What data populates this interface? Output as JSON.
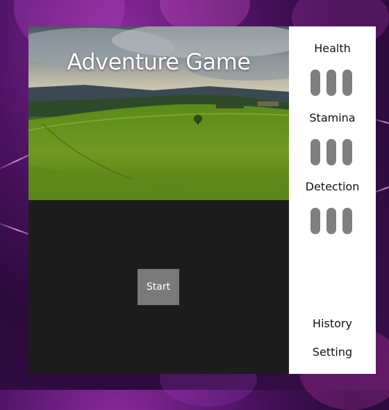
{
  "game": {
    "title": "Adventure Game",
    "start_label": "Start"
  },
  "stats": [
    {
      "label": "Health",
      "value": 3,
      "max": 3
    },
    {
      "label": "Stamina",
      "value": 3,
      "max": 3
    },
    {
      "label": "Detection",
      "value": 3,
      "max": 3
    }
  ],
  "menu": {
    "history_label": "History",
    "setting_label": "Setting"
  },
  "colors": {
    "panel_dark": "#1c1c1c",
    "button_gray": "#7a7a7a",
    "pip_gray": "#7f7f7f",
    "sidebar_white": "#ffffff"
  }
}
